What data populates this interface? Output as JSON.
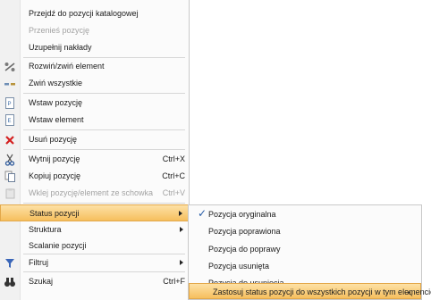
{
  "menu": {
    "goto_catalog": "Przejdź do pozycji katalogowej",
    "move_position": "Przenieś pozycję",
    "complete_inputs": "Uzupełnij nakłady",
    "expand_collapse": "Rozwiń/zwiń element",
    "collapse_all": "Zwiń wszystkie",
    "insert_position": "Wstaw pozycję",
    "insert_element": "Wstaw element",
    "delete_position": "Usuń pozycję",
    "cut_position": "Wytnij pozycję",
    "cut_shortcut": "Ctrl+X",
    "copy_position": "Kopiuj pozycję",
    "copy_shortcut": "Ctrl+C",
    "paste_position": "Wklej pozycję/element ze schowka",
    "paste_shortcut": "Ctrl+V",
    "position_status": "Status pozycji",
    "structure": "Struktura",
    "merge_positions": "Scalanie pozycji",
    "filter": "Filtruj",
    "search": "Szukaj",
    "search_shortcut": "Ctrl+F"
  },
  "submenu": {
    "original": "Pozycja oryginalna",
    "corrected": "Pozycja poprawiona",
    "to_correct": "Pozycja do poprawy",
    "deleted": "Pozycja usunięta",
    "to_delete": "Pozycja do usunięcia",
    "apply_all": "Zastosuj status pozycji do wszystkich pozycji w tym elemencie",
    "checkmark": "✓"
  }
}
